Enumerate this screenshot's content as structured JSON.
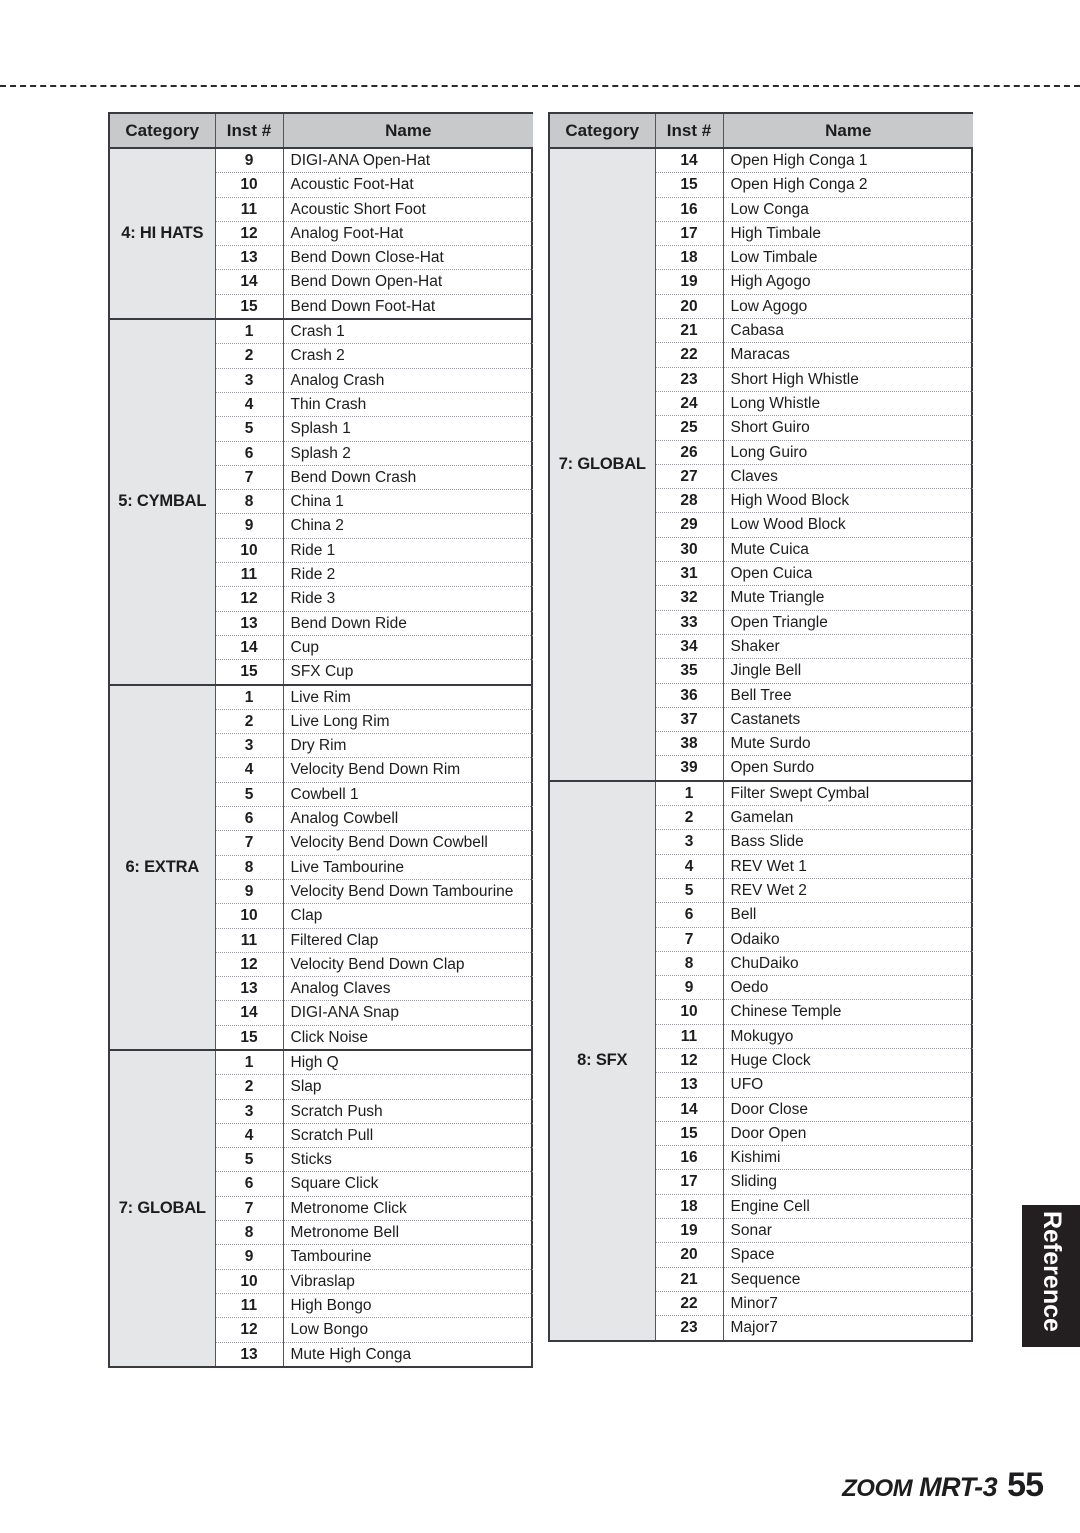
{
  "page": {
    "footer_brand_zoom": "ZOOM",
    "footer_brand_model": "MRT-3",
    "page_number": "55",
    "side_tab_label": "Reference"
  },
  "columns": {
    "category": "Category",
    "inst": "Inst #",
    "name": "Name"
  },
  "left_table": {
    "sections": [
      {
        "category": "4: HI HATS",
        "rows": [
          {
            "inst": "9",
            "name": "DIGI-ANA Open-Hat"
          },
          {
            "inst": "10",
            "name": "Acoustic Foot-Hat"
          },
          {
            "inst": "11",
            "name": "Acoustic Short Foot"
          },
          {
            "inst": "12",
            "name": "Analog Foot-Hat"
          },
          {
            "inst": "13",
            "name": "Bend Down Close-Hat"
          },
          {
            "inst": "14",
            "name": "Bend Down Open-Hat"
          },
          {
            "inst": "15",
            "name": "Bend Down Foot-Hat"
          }
        ]
      },
      {
        "category": "5: CYMBAL",
        "rows": [
          {
            "inst": "1",
            "name": "Crash 1"
          },
          {
            "inst": "2",
            "name": "Crash 2"
          },
          {
            "inst": "3",
            "name": "Analog Crash"
          },
          {
            "inst": "4",
            "name": "Thin Crash"
          },
          {
            "inst": "5",
            "name": "Splash 1"
          },
          {
            "inst": "6",
            "name": "Splash 2"
          },
          {
            "inst": "7",
            "name": "Bend Down Crash"
          },
          {
            "inst": "8",
            "name": "China 1"
          },
          {
            "inst": "9",
            "name": "China 2"
          },
          {
            "inst": "10",
            "name": "Ride 1"
          },
          {
            "inst": "11",
            "name": "Ride 2"
          },
          {
            "inst": "12",
            "name": "Ride 3"
          },
          {
            "inst": "13",
            "name": "Bend Down Ride"
          },
          {
            "inst": "14",
            "name": "Cup"
          },
          {
            "inst": "15",
            "name": "SFX Cup"
          }
        ]
      },
      {
        "category": "6: EXTRA",
        "rows": [
          {
            "inst": "1",
            "name": "Live Rim"
          },
          {
            "inst": "2",
            "name": "Live Long Rim"
          },
          {
            "inst": "3",
            "name": "Dry Rim"
          },
          {
            "inst": "4",
            "name": "Velocity Bend Down Rim"
          },
          {
            "inst": "5",
            "name": "Cowbell 1"
          },
          {
            "inst": "6",
            "name": "Analog Cowbell"
          },
          {
            "inst": "7",
            "name": "Velocity Bend Down Cowbell"
          },
          {
            "inst": "8",
            "name": "Live Tambourine"
          },
          {
            "inst": "9",
            "name": "Velocity Bend Down Tambourine"
          },
          {
            "inst": "10",
            "name": "Clap"
          },
          {
            "inst": "11",
            "name": "Filtered Clap"
          },
          {
            "inst": "12",
            "name": "Velocity Bend Down Clap"
          },
          {
            "inst": "13",
            "name": "Analog Claves"
          },
          {
            "inst": "14",
            "name": "DIGI-ANA Snap"
          },
          {
            "inst": "15",
            "name": "Click Noise"
          }
        ]
      },
      {
        "category": "7: GLOBAL",
        "rows": [
          {
            "inst": "1",
            "name": "High Q"
          },
          {
            "inst": "2",
            "name": "Slap"
          },
          {
            "inst": "3",
            "name": "Scratch Push"
          },
          {
            "inst": "4",
            "name": "Scratch Pull"
          },
          {
            "inst": "5",
            "name": "Sticks"
          },
          {
            "inst": "6",
            "name": "Square Click"
          },
          {
            "inst": "7",
            "name": "Metronome Click"
          },
          {
            "inst": "8",
            "name": "Metronome Bell"
          },
          {
            "inst": "9",
            "name": "Tambourine"
          },
          {
            "inst": "10",
            "name": "Vibraslap"
          },
          {
            "inst": "11",
            "name": "High Bongo"
          },
          {
            "inst": "12",
            "name": "Low Bongo"
          },
          {
            "inst": "13",
            "name": "Mute High Conga"
          }
        ]
      }
    ]
  },
  "right_table": {
    "sections": [
      {
        "category": "7: GLOBAL",
        "rows": [
          {
            "inst": "14",
            "name": "Open High Conga 1"
          },
          {
            "inst": "15",
            "name": "Open High Conga 2"
          },
          {
            "inst": "16",
            "name": "Low Conga"
          },
          {
            "inst": "17",
            "name": "High Timbale"
          },
          {
            "inst": "18",
            "name": "Low Timbale"
          },
          {
            "inst": "19",
            "name": "High Agogo"
          },
          {
            "inst": "20",
            "name": "Low Agogo"
          },
          {
            "inst": "21",
            "name": "Cabasa"
          },
          {
            "inst": "22",
            "name": "Maracas"
          },
          {
            "inst": "23",
            "name": "Short High Whistle"
          },
          {
            "inst": "24",
            "name": "Long Whistle"
          },
          {
            "inst": "25",
            "name": "Short Guiro"
          },
          {
            "inst": "26",
            "name": "Long Guiro"
          },
          {
            "inst": "27",
            "name": "Claves"
          },
          {
            "inst": "28",
            "name": "High Wood Block"
          },
          {
            "inst": "29",
            "name": "Low Wood Block"
          },
          {
            "inst": "30",
            "name": "Mute Cuica"
          },
          {
            "inst": "31",
            "name": "Open Cuica"
          },
          {
            "inst": "32",
            "name": "Mute Triangle"
          },
          {
            "inst": "33",
            "name": "Open Triangle"
          },
          {
            "inst": "34",
            "name": "Shaker"
          },
          {
            "inst": "35",
            "name": "Jingle Bell"
          },
          {
            "inst": "36",
            "name": "Bell Tree"
          },
          {
            "inst": "37",
            "name": "Castanets"
          },
          {
            "inst": "38",
            "name": "Mute Surdo"
          },
          {
            "inst": "39",
            "name": "Open Surdo"
          }
        ]
      },
      {
        "category": "8: SFX",
        "rows": [
          {
            "inst": "1",
            "name": "Filter Swept Cymbal"
          },
          {
            "inst": "2",
            "name": "Gamelan"
          },
          {
            "inst": "3",
            "name": "Bass Slide"
          },
          {
            "inst": "4",
            "name": "REV Wet 1"
          },
          {
            "inst": "5",
            "name": "REV Wet 2"
          },
          {
            "inst": "6",
            "name": "Bell"
          },
          {
            "inst": "7",
            "name": "Odaiko"
          },
          {
            "inst": "8",
            "name": "ChuDaiko"
          },
          {
            "inst": "9",
            "name": "Oedo"
          },
          {
            "inst": "10",
            "name": "Chinese Temple"
          },
          {
            "inst": "11",
            "name": "Mokugyo"
          },
          {
            "inst": "12",
            "name": "Huge Clock"
          },
          {
            "inst": "13",
            "name": "UFO"
          },
          {
            "inst": "14",
            "name": "Door Close"
          },
          {
            "inst": "15",
            "name": "Door Open"
          },
          {
            "inst": "16",
            "name": "Kishimi"
          },
          {
            "inst": "17",
            "name": "Sliding"
          },
          {
            "inst": "18",
            "name": "Engine Cell"
          },
          {
            "inst": "19",
            "name": "Sonar"
          },
          {
            "inst": "20",
            "name": "Space"
          },
          {
            "inst": "21",
            "name": "Sequence"
          },
          {
            "inst": "22",
            "name": "Minor7"
          },
          {
            "inst": "23",
            "name": "Major7"
          }
        ]
      }
    ]
  }
}
